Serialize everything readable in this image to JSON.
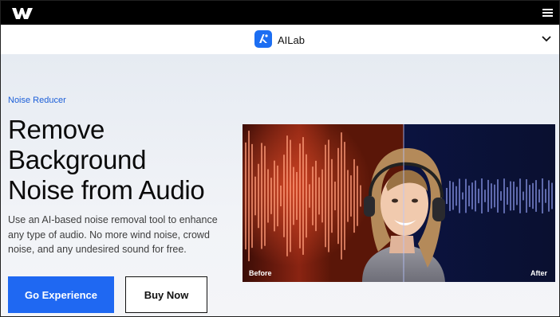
{
  "topbar": {
    "logo_icon": "wondershare-logo-icon",
    "menu_icon": "hamburger-menu-icon"
  },
  "subnav": {
    "label": "AILab",
    "icon": "ai-lab-icon",
    "expand_icon": "chevron-down-icon",
    "accent": "#1c6ef2"
  },
  "hero": {
    "eyebrow": "Noise Reducer",
    "title_lines": [
      "Remove",
      "Background",
      "Noise from Audio"
    ],
    "description": "Use an AI-based noise removal tool to enhance any type of audio. No more wind noise, crowd noise, and any undesired sound for free.",
    "primary_button": "Go Experience",
    "secondary_button": "Buy Now",
    "primary_color": "#1f68f2"
  },
  "comparison": {
    "before_label": "Before",
    "after_label": "After"
  }
}
